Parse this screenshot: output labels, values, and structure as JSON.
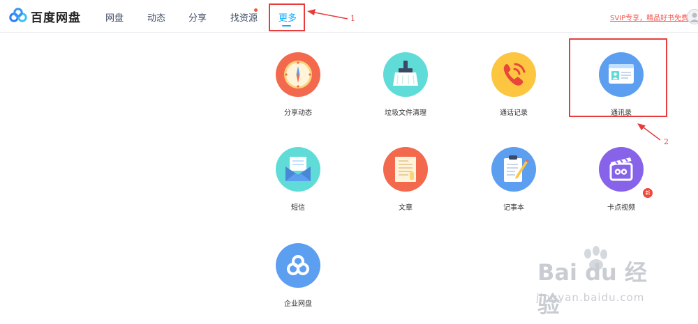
{
  "header": {
    "brand": "百度网盘",
    "nav": [
      "网盘",
      "动态",
      "分享",
      "找资源",
      "更多"
    ],
    "svip_link": "SVIP专享，精品好书免费领",
    "accent_color": "#09aaff"
  },
  "grid": {
    "items": [
      {
        "label": "分享动态",
        "icon": "compass-icon",
        "color": "#f2694e"
      },
      {
        "label": "垃圾文件清理",
        "icon": "broom-icon",
        "color": "#5fdcd7"
      },
      {
        "label": "通话记录",
        "icon": "phone-icon",
        "color": "#fcc640"
      },
      {
        "label": "通讯录",
        "icon": "contact-card-icon",
        "color": "#5c9ef0"
      },
      {
        "label": "短信",
        "icon": "envelope-icon",
        "color": "#5fdcd7"
      },
      {
        "label": "文章",
        "icon": "article-icon",
        "color": "#f2694e"
      },
      {
        "label": "记事本",
        "icon": "notepad-icon",
        "color": "#5c9ef0"
      },
      {
        "label": "卡点视频",
        "icon": "clapperboard-icon",
        "color": "#8663e8"
      },
      {
        "label": "企业网盘",
        "icon": "enterprise-cloud-icon",
        "color": "#5c9ef0"
      }
    ],
    "new_badge": "新"
  },
  "annotations": {
    "num1": "1",
    "num2": "2",
    "color": "#e73c3c"
  },
  "watermark": {
    "logo_text": "Bai  du 经验",
    "sub": "jingyan.baidu.com"
  }
}
